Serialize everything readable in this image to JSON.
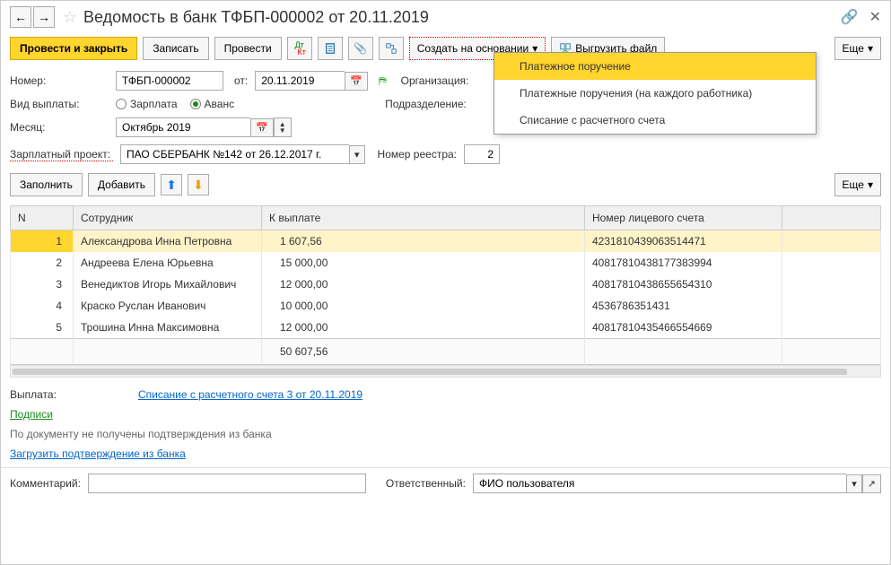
{
  "header": {
    "title": "Ведомость в банк ТФБП-000002 от 20.11.2019"
  },
  "toolbar": {
    "post_close": "Провести и закрыть",
    "save": "Записать",
    "post": "Провести",
    "create_based": "Создать на основании",
    "upload": "Выгрузить файл",
    "more": "Еще"
  },
  "create_menu": {
    "items": [
      "Платежное поручение",
      "Платежные поручения (на каждого работника)",
      "Списание с расчетного счета"
    ]
  },
  "form": {
    "number_label": "Номер:",
    "number_value": "ТФБП-000002",
    "date_label": "от:",
    "date_value": "20.11.2019",
    "org_label": "Организация:",
    "paytype_label": "Вид выплаты:",
    "paytype_salary": "Зарплата",
    "paytype_advance": "Аванс",
    "dept_label": "Подразделение:",
    "month_label": "Месяц:",
    "month_value": "Октябрь 2019",
    "project_label": "Зарплатный проект:",
    "project_value": "ПАО СБЕРБАНК №142 от 26.12.2017 г.",
    "registry_label": "Номер реестра:",
    "registry_value": "2"
  },
  "sec_toolbar": {
    "fill": "Заполнить",
    "add": "Добавить",
    "more": "Еще"
  },
  "table": {
    "headers": {
      "n": "N",
      "employee": "Сотрудник",
      "amount": "К выплате",
      "account": "Номер лицевого счета"
    },
    "rows": [
      {
        "n": "1",
        "employee": "Александрова Инна Петровна",
        "amount": "1 607,56",
        "account": "4231810439063514471"
      },
      {
        "n": "2",
        "employee": "Андреева Елена Юрьевна",
        "amount": "15 000,00",
        "account": "40817810438177383994"
      },
      {
        "n": "3",
        "employee": "Венедиктов Игорь Михайлович",
        "amount": "12 000,00",
        "account": "40817810438655654310"
      },
      {
        "n": "4",
        "employee": "Краско Руслан Иванович",
        "amount": "10 000,00",
        "account": "4536786351431"
      },
      {
        "n": "5",
        "employee": "Трошина Инна Максимовна",
        "amount": "12 000,00",
        "account": "40817810435466554669"
      }
    ],
    "total": "50 607,56"
  },
  "bottom": {
    "payment_label": "Выплата:",
    "payment_link": "Списание с расчетного счета 3 от 20.11.2019",
    "signs": "Подписи",
    "no_confirm": "По документу не получены подтверждения из банка",
    "load_confirm": "Загрузить подтверждение из банка",
    "comment_label": "Комментарий:",
    "resp_label": "Ответственный:",
    "resp_value": "ФИО пользователя"
  }
}
